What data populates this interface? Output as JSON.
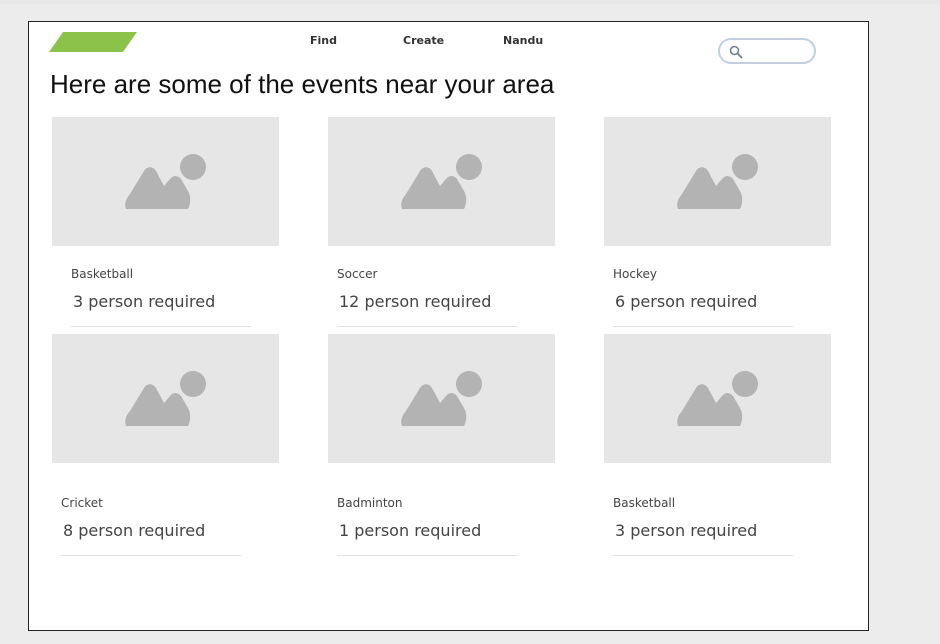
{
  "header": {
    "nav": [
      "Find",
      "Create",
      "Nandu"
    ],
    "search": {
      "placeholder": "",
      "value": ""
    },
    "logo_color": "#8bc34a"
  },
  "main": {
    "heading": "Here are some of the events near your area",
    "events": [
      {
        "sport": "Basketball",
        "required": "3 person required"
      },
      {
        "sport": "Soccer",
        "required": "12 person required"
      },
      {
        "sport": "Hockey",
        "required": "6 person required"
      },
      {
        "sport": "Cricket",
        "required": "8 person required"
      },
      {
        "sport": "Badminton",
        "required": "1 person required"
      },
      {
        "sport": "Basketball",
        "required": "3 person required"
      }
    ]
  },
  "icons": {
    "search": "search-icon",
    "thumbnail": "image-placeholder-icon"
  }
}
